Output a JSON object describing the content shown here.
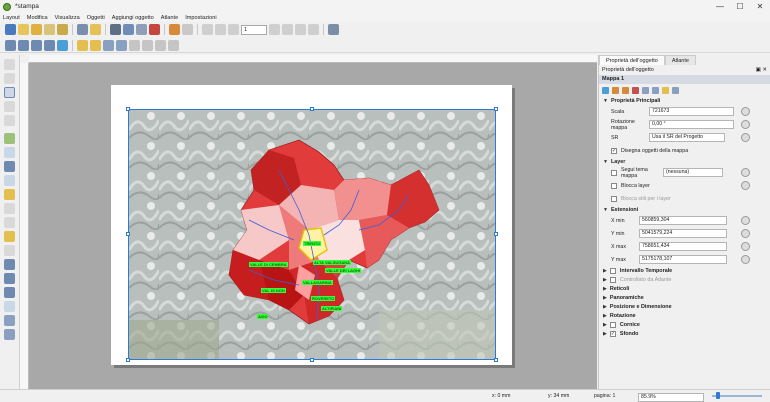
{
  "window": {
    "title": "*stampa"
  },
  "menu": [
    "Layout",
    "Modifica",
    "Visualizza",
    "Oggetti",
    "Aggiungi oggetto",
    "Atlante",
    "Impostazioni"
  ],
  "toolbar": {
    "page_value": "1"
  },
  "panel": {
    "tabs": [
      "Proprietà dell'oggetto",
      "Atlante"
    ],
    "header": "Proprietà dell'oggetto",
    "item_title": "Mappa 1",
    "sections": {
      "principali": "Proprietà Principali",
      "layer": "Layer",
      "estensioni": "Estensioni",
      "intervallo": "Intervallo Temporale",
      "controllato": "Controllato da Atlante",
      "reticoli": "Reticoli",
      "panoramiche": "Panoramiche",
      "posizione": "Posizione e Dimensione",
      "rotazione": "Rotazione",
      "cornice": "Cornice",
      "sfondo": "Sfondo"
    },
    "scala_label": "Scala",
    "scala_value": "721673",
    "rotazione_label": "Rotazione mappa",
    "rotazione_value": "0,00 °",
    "sr_label": "SR",
    "sr_value": "Usa il SR del Progetto",
    "disegna_label": "Disegna oggetti della mappa",
    "segui_label": "Segui tema mappa",
    "segui_value": "(nessuna)",
    "blocca_label": "Blocca layer",
    "blocca_stili_label": "Blocca stili per i layer",
    "xmin_label": "X min",
    "xmin_value": "560859,304",
    "ymin_label": "Y min",
    "ymin_value": "5041579,224",
    "xmax_label": "X max",
    "xmax_value": "758651,434",
    "ymax_label": "Y max",
    "ymax_value": "5175178,107"
  },
  "map_labels": [
    "TRENTO",
    "VALLE DI CEMBRA",
    "ALTA VALSUGANA",
    "VALLE DEI LAGHI",
    "VALLAGARINA",
    "VAL DI NON",
    "ROVERETO",
    "ALTIPIANI",
    "AVIO"
  ],
  "status": {
    "x": "x: 0 mm",
    "y": "y: 34 mm",
    "pagina_label": "pagina: 1",
    "zoom_value": "85.9%"
  },
  "colors": {
    "accent": "#2e7bd6",
    "map_label_bg": "#36ff3a",
    "panel_title": "#d6dbe3"
  }
}
